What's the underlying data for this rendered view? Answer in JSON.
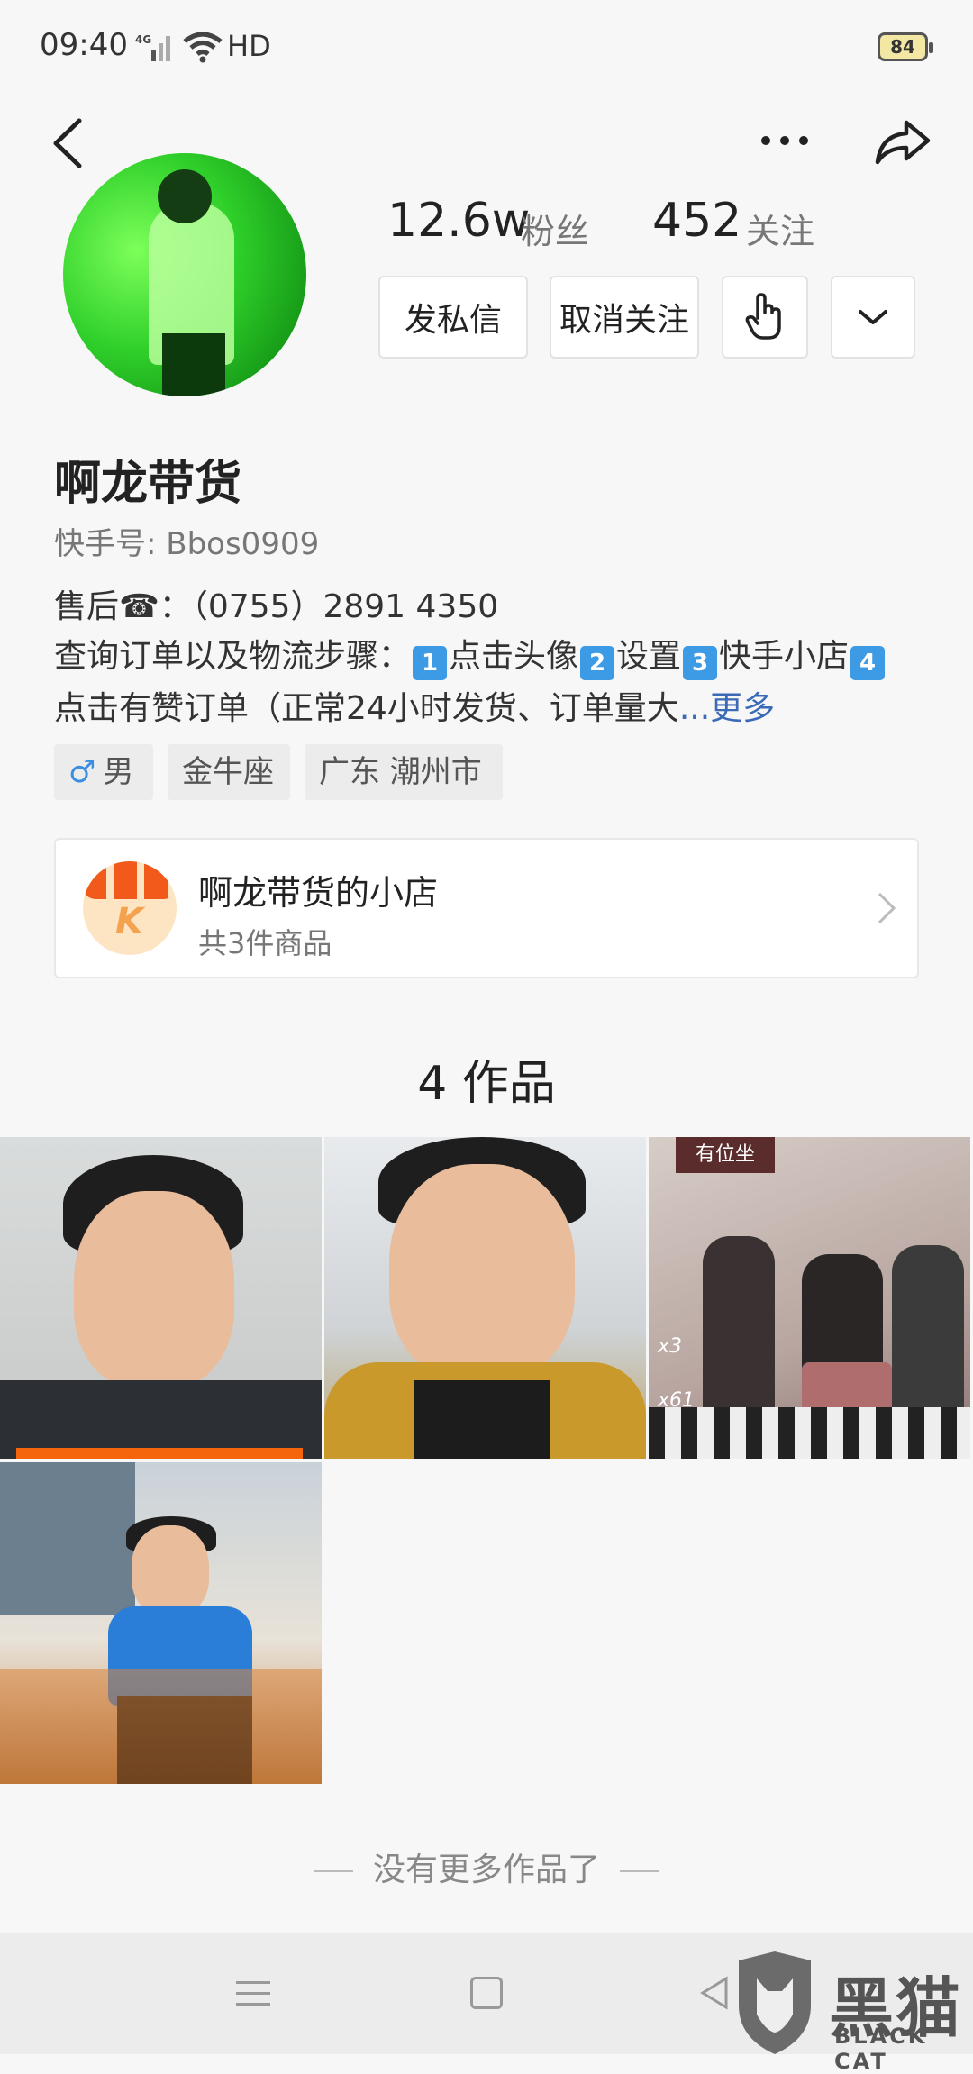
{
  "status_bar": {
    "time": "09:40",
    "network": "4G",
    "hd": "HD",
    "battery": "84"
  },
  "header": {
    "back_icon": "back-arrow-icon",
    "more_icon": "more-dots-icon",
    "share_icon": "share-icon"
  },
  "profile": {
    "fans_count": "12.6w",
    "fans_label": "粉丝",
    "following_count": "452",
    "following_label": "关注",
    "name": "啊龙带货",
    "kuaishou_id": "快手号: Bbos0909",
    "after_sale": "售后☎：（0755）2891 4350",
    "bio_part1": "查询订单以及物流步骤：",
    "bio_n1": "1",
    "bio_s1": "点击头像",
    "bio_n2": "2",
    "bio_s2": "设置",
    "bio_n3": "3",
    "bio_s3": "快手小店",
    "bio_n4": "4",
    "bio_s4": "点击有赞订单（正常24小时发货、订单量大",
    "bio_ellipsis": "...",
    "bio_more": "更多"
  },
  "actions": {
    "message": "发私信",
    "unfollow": "取消关注",
    "gesture_icon": "hand-pointer-icon",
    "dropdown_icon": "chevron-down-icon"
  },
  "tags": {
    "gender_symbol": "♂",
    "gender": "男",
    "zodiac": "金牛座",
    "location": "广东 潮州市"
  },
  "shop": {
    "name": "啊龙带货的小店",
    "count": "共3件商品",
    "logo_letter": "K"
  },
  "works": {
    "title": "4 作品",
    "items": [
      {
        "overlay": ""
      },
      {
        "overlay": ""
      },
      {
        "overlay": "x3",
        "overlay2": "x61",
        "sign": "有位坐"
      },
      {
        "overlay": ""
      }
    ],
    "no_more": "没有更多作品了"
  },
  "watermark": {
    "text": "黑猫",
    "sub": "BLACK CAT"
  }
}
